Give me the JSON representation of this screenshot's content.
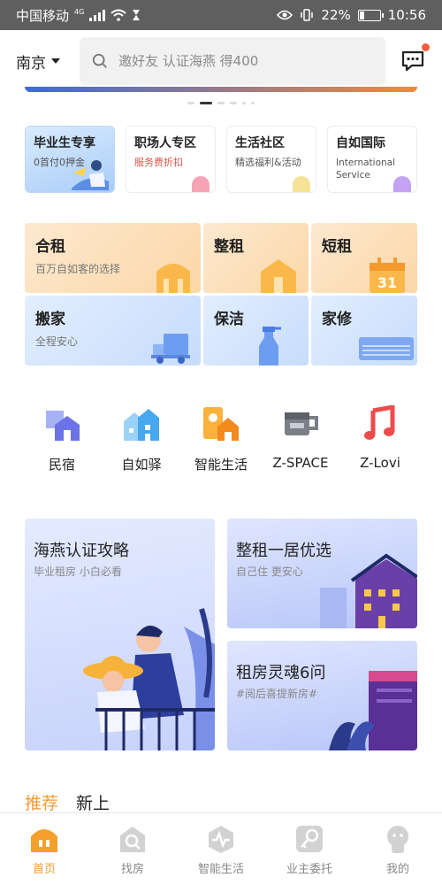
{
  "status_bar": {
    "carrier": "中国移动",
    "network": "4G",
    "battery": "22%",
    "battery_level": 0.22,
    "time": "10:56"
  },
  "header": {
    "city": "南京",
    "search_placeholder": "邀好友 认证海燕 得400",
    "has_unread": true
  },
  "banner": {
    "dots_count": 6,
    "active_index": 1
  },
  "features": [
    {
      "title": "毕业生专享",
      "subtitle": "0首付0押金",
      "accent": "#bcd7f7"
    },
    {
      "title": "职场人专区",
      "subtitle": "服务费折扣",
      "accent": "#f7a8b8"
    },
    {
      "title": "生活社区",
      "subtitle": "精选福利&活动",
      "accent": "#f7e6a0"
    },
    {
      "title": "自如国际",
      "subtitle": "International Service",
      "accent": "#c8a8f5"
    }
  ],
  "rent_grid": {
    "row1": [
      {
        "title": "合租",
        "subtitle": "百万自如客的选择"
      },
      {
        "title": "整租",
        "subtitle": ""
      },
      {
        "title": "短租",
        "subtitle": ""
      }
    ],
    "row2": [
      {
        "title": "搬家",
        "subtitle": "全程安心"
      },
      {
        "title": "保洁",
        "subtitle": ""
      },
      {
        "title": "家修",
        "subtitle": ""
      }
    ]
  },
  "services": [
    {
      "label": "民宿",
      "icon": "house-icon"
    },
    {
      "label": "自如驿",
      "icon": "building-icon"
    },
    {
      "label": "智能生活",
      "icon": "smart-home-icon"
    },
    {
      "label": "Z-SPACE",
      "icon": "cup-icon"
    },
    {
      "label": "Z-Lovi",
      "icon": "music-note-icon"
    }
  ],
  "promos": {
    "big": {
      "title": "海燕认证攻略",
      "subtitle": "毕业租房 小白必看"
    },
    "right_top": {
      "title": "整租一居优选",
      "subtitle": "自己住 更安心"
    },
    "right_bottom": {
      "title": "租房灵魂6问",
      "subtitle": "#阅后喜提新房#"
    }
  },
  "tabs": [
    {
      "label": "推荐",
      "active": true
    },
    {
      "label": "新上",
      "active": false
    }
  ],
  "bottom_nav": [
    {
      "label": "首页",
      "icon": "home-icon",
      "active": true
    },
    {
      "label": "找房",
      "icon": "find-house-icon",
      "active": false
    },
    {
      "label": "智能生活",
      "icon": "pulse-icon",
      "active": false
    },
    {
      "label": "业主委托",
      "icon": "key-icon",
      "active": false
    },
    {
      "label": "我的",
      "icon": "profile-icon",
      "active": false
    }
  ],
  "colors": {
    "accent_orange": "#f39c33",
    "badge_red": "#f25b3b",
    "status_bar": "#5f5f5f"
  }
}
